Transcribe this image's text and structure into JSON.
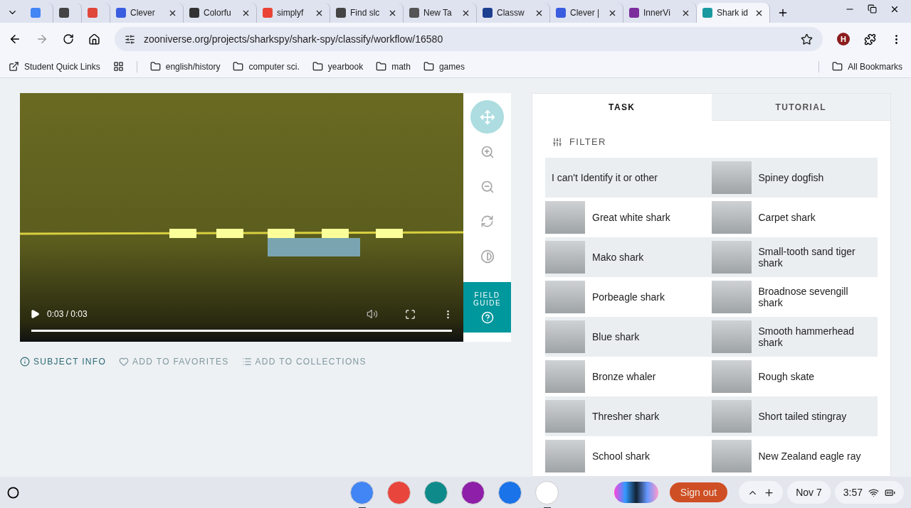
{
  "browser": {
    "tabs": [
      {
        "selected": false,
        "color": "#4285f4"
      },
      {
        "selected": false,
        "color": "#444444"
      },
      {
        "selected": false,
        "color": "#e0463a"
      },
      {
        "label": "Clever",
        "selected": false,
        "color": "#3a5de0"
      },
      {
        "label": "Colorfu",
        "selected": false,
        "color": "#333333"
      },
      {
        "label": "simplyf",
        "selected": false,
        "color": "#ea4335"
      },
      {
        "label": "Find slc",
        "selected": false,
        "color": "#444444"
      },
      {
        "label": "New Ta",
        "selected": false,
        "color": "#555555"
      },
      {
        "label": "Classw",
        "selected": false,
        "color": "#1d3f8f"
      },
      {
        "label": "Clever |",
        "selected": false,
        "color": "#3a5de0"
      },
      {
        "label": "InnerVi",
        "selected": false,
        "color": "#7b2d9b"
      },
      {
        "label": "Shark id",
        "selected": true,
        "color": "#1a9aa0"
      }
    ],
    "url": "zooniverse.org/projects/sharkspy/shark-spy/classify/workflow/16580",
    "profile_initial": "H",
    "bookmarks": [
      {
        "label": "Student Quick Links",
        "kind": "link"
      },
      {
        "kind": "apps"
      },
      {
        "label": "english/history",
        "kind": "folder"
      },
      {
        "label": "computer sci.",
        "kind": "folder"
      },
      {
        "label": "yearbook",
        "kind": "folder"
      },
      {
        "label": "math",
        "kind": "folder"
      },
      {
        "label": "games",
        "kind": "folder"
      }
    ],
    "all_bookmarks": "All Bookmarks"
  },
  "video": {
    "time": "0:03 / 0:03",
    "level": 1
  },
  "tools": [
    {
      "kind": "pan",
      "selected": true
    },
    {
      "kind": "zoom-in",
      "selected": false
    },
    {
      "kind": "zoom-out",
      "selected": false
    },
    {
      "kind": "rotate",
      "selected": false
    },
    {
      "kind": "invert",
      "selected": false
    }
  ],
  "field_guide": "FIELD GUIDE",
  "subject_actions": [
    {
      "label": "SUBJECT INFO",
      "kind": "info",
      "disabled": false
    },
    {
      "label": "ADD TO FAVORITES",
      "kind": "favorite",
      "disabled": true
    },
    {
      "label": "ADD TO COLLECTIONS",
      "kind": "collection",
      "disabled": true
    }
  ],
  "panel": {
    "tabs": [
      {
        "label": "TASK",
        "selected": true
      },
      {
        "label": "TUTORIAL",
        "selected": false
      }
    ],
    "filter": "FILTER",
    "choices": [
      {
        "label": "I can't Identify it or other",
        "kind": "text"
      },
      {
        "label": "Spiney dogfish",
        "kind": "photo"
      },
      {
        "label": "Great white shark",
        "kind": "photo"
      },
      {
        "label": "Carpet shark",
        "kind": "photo"
      },
      {
        "label": "Mako shark",
        "kind": "photo"
      },
      {
        "label": "Small-tooth sand tiger shark",
        "kind": "photo"
      },
      {
        "label": "Porbeagle shark",
        "kind": "photo"
      },
      {
        "label": "Broadnose sevengill shark",
        "kind": "photo"
      },
      {
        "label": "Blue shark",
        "kind": "photo"
      },
      {
        "label": "Smooth hammerhead shark",
        "kind": "photo"
      },
      {
        "label": "Bronze whaler",
        "kind": "photo"
      },
      {
        "label": "Rough skate",
        "kind": "photo"
      },
      {
        "label": "Thresher shark",
        "kind": "photo"
      },
      {
        "label": "Short tailed stingray",
        "kind": "photo"
      },
      {
        "label": "School shark",
        "kind": "photo"
      },
      {
        "label": "New Zealand eagle ray",
        "kind": "photo"
      }
    ]
  },
  "taskbar": {
    "apps": [
      {
        "color": "#4285f4",
        "running": true
      },
      {
        "color": "#e8453c",
        "running": false
      },
      {
        "color": "#0f8a8a",
        "running": false
      },
      {
        "color": "#8e1fa8",
        "running": false
      },
      {
        "color": "#1a73e8",
        "running": false
      },
      {
        "color": "#ffffff",
        "running": true
      }
    ],
    "sign_out": "Sign out",
    "date": "Nov 7",
    "time": "3:57"
  }
}
